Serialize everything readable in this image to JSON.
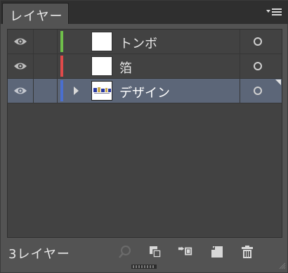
{
  "panel": {
    "tab_label": "レイヤー",
    "menu_icon": "panel-menu-icon"
  },
  "layers": [
    {
      "name": "トンボ",
      "color": "#6fbf4a",
      "visible": true,
      "selected": false,
      "expandable": false,
      "thumbnail": "blank"
    },
    {
      "name": "箔",
      "color": "#e04a4a",
      "visible": true,
      "selected": false,
      "expandable": false,
      "thumbnail": "blank"
    },
    {
      "name": "デザイン",
      "color": "#4a6fd0",
      "visible": true,
      "selected": true,
      "expandable": true,
      "thumbnail": "design"
    }
  ],
  "footer": {
    "layer_count": "3レイヤー",
    "icons": [
      "locate-object-icon",
      "make-clipping-mask-icon",
      "create-sublayer-icon",
      "create-new-layer-icon",
      "delete-layer-icon"
    ]
  },
  "colors": {
    "panel_bg": "#535353",
    "list_bg": "#424242",
    "selected_row": "#5c6678"
  }
}
